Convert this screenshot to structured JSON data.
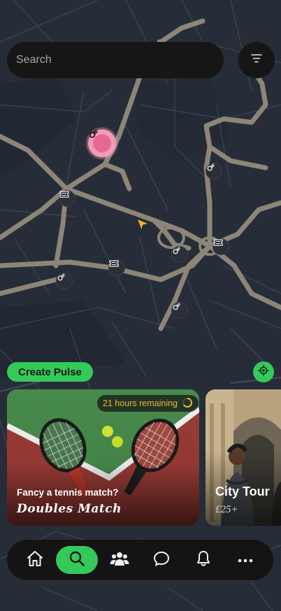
{
  "search": {
    "placeholder": "Search"
  },
  "map": {
    "pins": [
      {
        "type": "featured",
        "icon": "comet-icon"
      },
      {
        "type": "event",
        "icon": "comet-icon"
      },
      {
        "type": "ticket",
        "icon": "ticket-icon"
      },
      {
        "type": "event",
        "icon": "comet-icon"
      },
      {
        "type": "ticket",
        "icon": "ticket-icon"
      },
      {
        "type": "ticket",
        "icon": "ticket-icon"
      },
      {
        "type": "event",
        "icon": "comet-icon"
      },
      {
        "type": "event",
        "icon": "comet-icon"
      }
    ]
  },
  "actions": {
    "create_pulse": "Create Pulse"
  },
  "cards": [
    {
      "time_remaining": "21 hours remaining",
      "subtitle": "Fancy a tennis match?",
      "title": "Doubles Match"
    },
    {
      "title": "City Tour",
      "price": "£25+"
    }
  ],
  "nav": {
    "items": [
      {
        "icon": "home-icon",
        "active": false
      },
      {
        "icon": "search-icon",
        "active": true
      },
      {
        "icon": "people-icon",
        "active": false
      },
      {
        "icon": "chat-icon",
        "active": false
      },
      {
        "icon": "bell-icon",
        "active": false
      },
      {
        "icon": "more-icon",
        "active": false
      }
    ]
  },
  "colors": {
    "accent": "#35c95a",
    "featured_pin": "#f29bb8",
    "time_chip_text": "#f0b33a",
    "map_bg": "#262d38",
    "road": "#8d8577"
  }
}
